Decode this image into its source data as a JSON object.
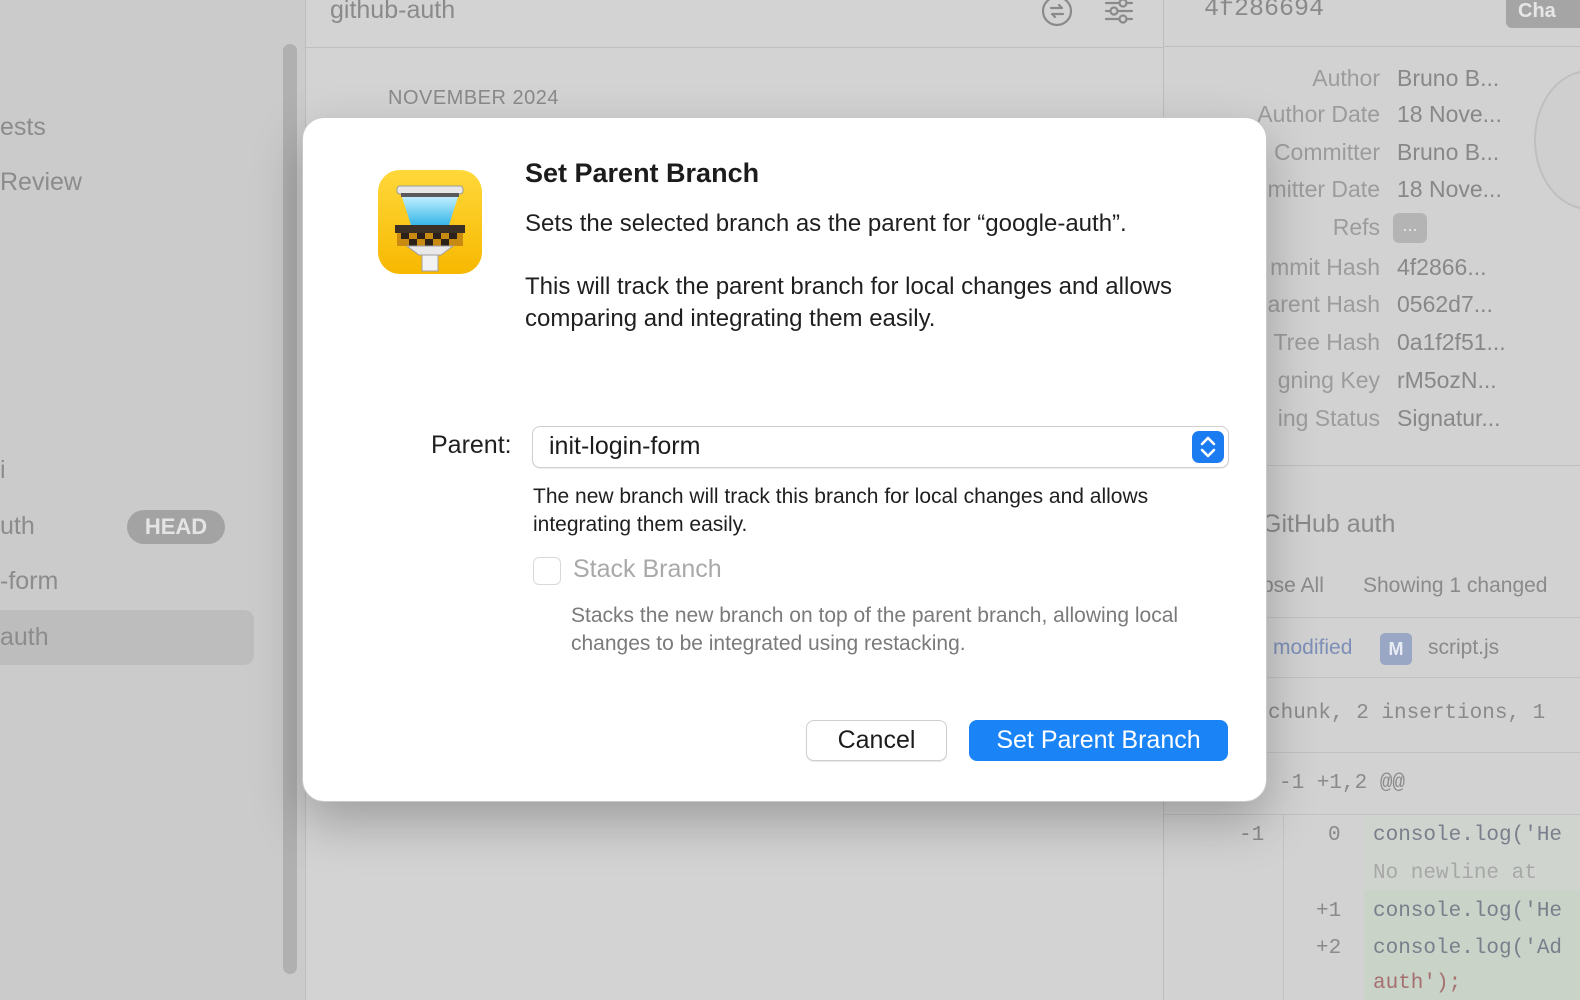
{
  "sidebar": {
    "items": [
      {
        "label": "ests"
      },
      {
        "label": " Review"
      },
      {
        "label": "i"
      },
      {
        "label": "uth"
      },
      {
        "label": "-form"
      },
      {
        "label": "auth"
      }
    ],
    "head_badge": "HEAD"
  },
  "commits": {
    "title": "github-auth",
    "month": "NOVEMBER 2024"
  },
  "details": {
    "hash": "4f286694",
    "chip": "Cha",
    "meta": [
      {
        "label": "Author",
        "value": "Bruno B..."
      },
      {
        "label": "Author Date",
        "value": "18 Nove..."
      },
      {
        "label": "Committer",
        "value": "Bruno B..."
      },
      {
        "label": "mitter Date",
        "value": "18 Nove..."
      },
      {
        "label": "Refs",
        "value": ""
      },
      {
        "label": "mmit Hash",
        "value": "4f2866..."
      },
      {
        "label": "arent Hash",
        "value": "0562d7..."
      },
      {
        "label": "Tree Hash",
        "value": "0a1f2f51..."
      },
      {
        "label": "gning Key",
        "value": "rM5ozN..."
      },
      {
        "label": "ing Status",
        "value": "Signatur..."
      }
    ],
    "refs_chip": "...",
    "commit_title": "GitHub auth",
    "collapse_all": "pse All",
    "showing": "Showing 1 changed",
    "modified": "modified",
    "m_badge": "M",
    "file": "script.js",
    "chunk": "chunk, 2 insertions, 1",
    "hunk": "-1 +1,2 @@",
    "diff": [
      {
        "old": "-1",
        "new": "0",
        "text": "console.log('He"
      },
      {
        "old": "",
        "new": "",
        "text": " No newline at"
      },
      {
        "old": "",
        "new": "+1",
        "text": "console.log('He"
      },
      {
        "old": "",
        "new": "+2",
        "text": "console.log('Ad"
      },
      {
        "old": "",
        "new": "",
        "text": "auth');"
      }
    ]
  },
  "dialog": {
    "title": "Set Parent Branch",
    "description": "Sets the selected branch as the parent for “google-auth”.",
    "description2": "This will track the parent branch for local changes and allows comparing and integrating them easily.",
    "parent_label": "Parent:",
    "parent_value": "init-login-form",
    "parent_help": "The new branch will track this branch for local changes and allows integrating them easily.",
    "stack_label": "Stack Branch",
    "stack_checked": false,
    "stack_help": "Stacks the new branch on top of the parent branch, allowing local changes to be integrated using restacking.",
    "cancel_label": "Cancel",
    "confirm_label": "Set Parent Branch",
    "accent_color": "#1a84f7",
    "icon": "tower-app-icon"
  }
}
